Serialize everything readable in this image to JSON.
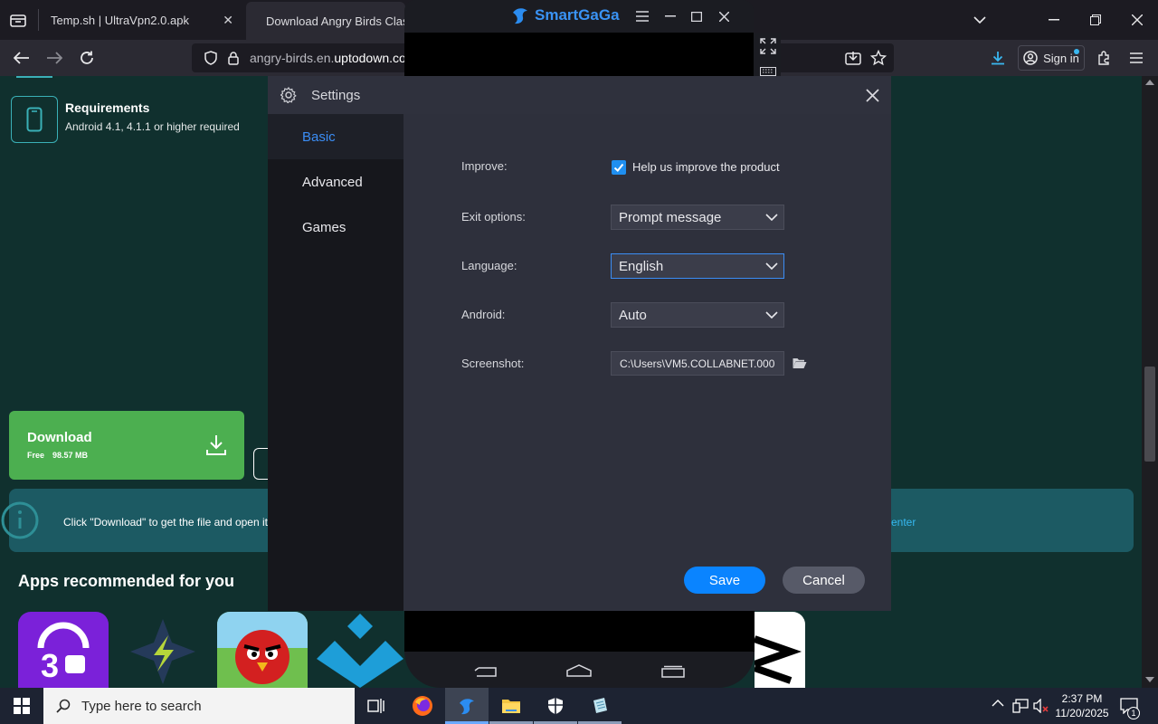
{
  "browser": {
    "tabs": [
      {
        "title": "Temp.sh | UltraVpn2.0.apk"
      },
      {
        "title": "Download Angry Birds Class"
      }
    ],
    "url": {
      "prefix": "angry-birds.en.",
      "domain": "uptodown.co"
    },
    "sign_in_label": "Sign in"
  },
  "page": {
    "requirements_title": "Requirements",
    "requirements_text": "Android 4.1, 4.1.1 or higher required",
    "download_label": "Download",
    "download_free": "Free",
    "download_size": "98.57 MB",
    "info_text": "Click \"Download\" to get the file and open it",
    "info_link_tail": "enter",
    "recommended_title": "Apps recommended for you"
  },
  "smartgaga": {
    "brand": "SmartGaGa"
  },
  "settings": {
    "title": "Settings",
    "tabs": [
      "Basic",
      "Advanced",
      "Games"
    ],
    "active_tab": "Basic",
    "improve_label": "Improve:",
    "improve_checkbox_label": "Help us improve the product",
    "improve_checked": true,
    "exit_label": "Exit options:",
    "exit_value": "Prompt message",
    "language_label": "Language:",
    "language_value": "English",
    "android_label": "Android:",
    "android_value": "Auto",
    "screenshot_label": "Screenshot:",
    "screenshot_path": "C:\\Users\\VM5.COLLABNET.000",
    "save_label": "Save",
    "cancel_label": "Cancel"
  },
  "taskbar": {
    "search_placeholder": "Type here to search",
    "time": "2:37 PM",
    "date": "11/20/2025",
    "notification_count": "1"
  },
  "colors": {
    "accent": "#0a84ff",
    "download_green": "#4caf50",
    "page_bg": "#10302e"
  }
}
